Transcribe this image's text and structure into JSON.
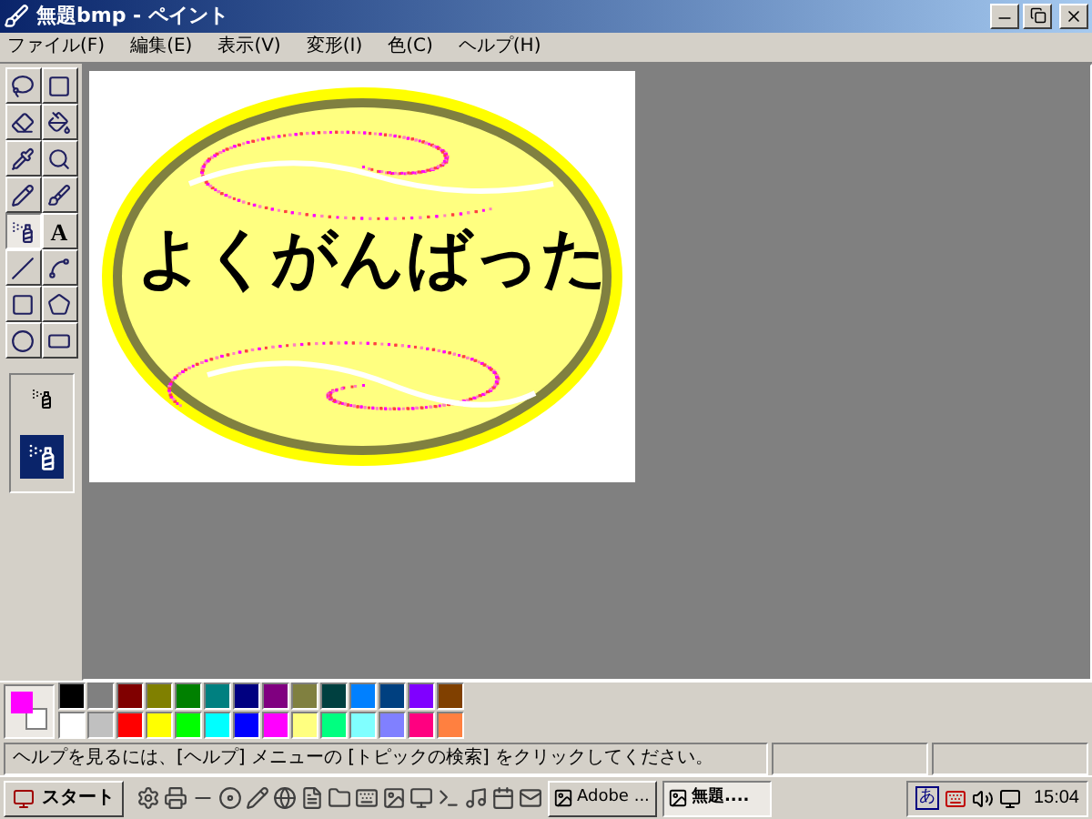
{
  "window": {
    "title": "無題bmp - ペイント"
  },
  "menu": [
    "ファイル(F)",
    "編集(E)",
    "表示(V)",
    "変形(I)",
    "色(C)",
    "ヘルプ(H)"
  ],
  "tools": [
    {
      "kind": "free-select",
      "selected": false
    },
    {
      "kind": "select",
      "selected": false
    },
    {
      "kind": "eraser",
      "selected": false
    },
    {
      "kind": "fill",
      "selected": false
    },
    {
      "kind": "picker",
      "selected": false
    },
    {
      "kind": "magnifier",
      "selected": false
    },
    {
      "kind": "pencil",
      "selected": false
    },
    {
      "kind": "brush",
      "selected": false
    },
    {
      "kind": "airbrush",
      "selected": true
    },
    {
      "kind": "text",
      "glyph": "A",
      "selected": false
    },
    {
      "kind": "line",
      "selected": false
    },
    {
      "kind": "curve",
      "selected": false
    },
    {
      "kind": "rectangle",
      "selected": false
    },
    {
      "kind": "polygon",
      "selected": false
    },
    {
      "kind": "ellipse",
      "selected": false
    },
    {
      "kind": "rounded-rectangle",
      "selected": false
    }
  ],
  "canvas": {
    "text": "よくがんばった"
  },
  "palette": {
    "foreground": {
      "color": "#ff00ff"
    },
    "background": {
      "color": "#ffffff"
    },
    "colors": [
      {
        "color": "#000000"
      },
      {
        "color": "#808080"
      },
      {
        "color": "#800000"
      },
      {
        "color": "#808000"
      },
      {
        "color": "#008000"
      },
      {
        "color": "#008080"
      },
      {
        "color": "#000080"
      },
      {
        "color": "#800080"
      },
      {
        "color": "#808040"
      },
      {
        "color": "#004040"
      },
      {
        "color": "#0080ff"
      },
      {
        "color": "#004080"
      },
      {
        "color": "#8000ff"
      },
      {
        "color": "#804000"
      },
      {
        "color": "#ffffff"
      },
      {
        "color": "#c0c0c0"
      },
      {
        "color": "#ff0000"
      },
      {
        "color": "#ffff00"
      },
      {
        "color": "#00ff00"
      },
      {
        "color": "#00ffff"
      },
      {
        "color": "#0000ff"
      },
      {
        "color": "#ff00ff"
      },
      {
        "color": "#ffff80"
      },
      {
        "color": "#00ff80"
      },
      {
        "color": "#80ffff"
      },
      {
        "color": "#8080ff"
      },
      {
        "color": "#ff0080"
      },
      {
        "color": "#ff8040"
      }
    ]
  },
  "status_bar": {
    "text": "ヘルプを見るには、[ヘルプ] メニューの [トピックの検索] をクリックしてください。"
  },
  "taskbar": {
    "start": "スタート",
    "tasks": [
      {
        "label": "Adobe ...",
        "selected": false
      },
      {
        "label": "無題....",
        "selected": true
      }
    ],
    "ime": "あ",
    "clock": "15:04"
  }
}
